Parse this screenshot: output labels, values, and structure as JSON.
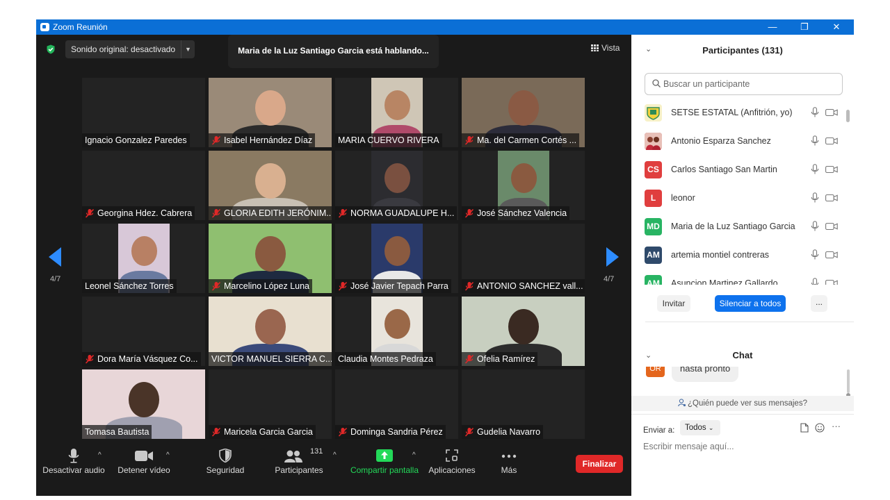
{
  "window": {
    "title": "Zoom Reunión",
    "minimize": "—",
    "restore": "❐",
    "close": "✕"
  },
  "meeting": {
    "original_sound": "Sonido original: desactivado",
    "speaking_banner": "Maria de la Luz Santiago Garcia está hablando...",
    "view_label": "Vista",
    "page_left": "4/7",
    "page_right": "4/7",
    "accent": "#2d8cff",
    "tiles": [
      {
        "name": "Ignacio Gonzalez Paredes",
        "muted": false
      },
      {
        "name": "Isabel Hernández Díaz",
        "muted": true
      },
      {
        "name": "MARIA CUERVO RIVERA",
        "muted": false
      },
      {
        "name": "Ma. del Carmen Cortés ...",
        "muted": true
      },
      {
        "name": "Georgina Hdez. Cabrera",
        "muted": true
      },
      {
        "name": "GLORIA EDITH JERÓNIM...",
        "muted": true
      },
      {
        "name": "NORMA GUADALUPE H...",
        "muted": true
      },
      {
        "name": "José Sánchez Valencia",
        "muted": true
      },
      {
        "name": "Leonel Sánchez Torres",
        "muted": false
      },
      {
        "name": "Marcelino López Luna",
        "muted": true
      },
      {
        "name": "José Javier Tepach Parra",
        "muted": true
      },
      {
        "name": "ANTONIO SANCHEZ vall...",
        "muted": true
      },
      {
        "name": "Dora María Vásquez Co...",
        "muted": true
      },
      {
        "name": "VICTOR MANUEL SIERRA C...",
        "muted": false
      },
      {
        "name": "Claudia Montes Pedraza",
        "muted": false
      },
      {
        "name": "Ofelia Ramírez",
        "muted": true
      },
      {
        "name": "Tomasa Bautista",
        "muted": false
      },
      {
        "name": "Maricela Garcia Garcia",
        "muted": true
      },
      {
        "name": "Dominga Sandria Pérez",
        "muted": true
      },
      {
        "name": "Gudelia Navarro",
        "muted": true
      }
    ]
  },
  "toolbar": {
    "mute": "Desactivar audio",
    "video": "Detener vídeo",
    "security": "Seguridad",
    "participants": "Participantes",
    "participants_count": "131",
    "share": "Compartir pantalla",
    "apps": "Aplicaciones",
    "more": "Más",
    "end": "Finalizar",
    "share_color": "#23d959",
    "end_color": "#e02828"
  },
  "panel": {
    "participants_title": "Participantes (131)",
    "search_placeholder": "Buscar un participante",
    "participants": [
      {
        "initials": "",
        "name": "SETSE ESTATAL (Anfitrión, yo)",
        "color": "#f2d13a"
      },
      {
        "initials": "",
        "name": "Antonio Esparza Sanchez",
        "color": "#c23a3a"
      },
      {
        "initials": "CS",
        "name": "Carlos Santiago San Martin",
        "color": "#e03e3e"
      },
      {
        "initials": "L",
        "name": "leonor",
        "color": "#e03e3e"
      },
      {
        "initials": "MD",
        "name": "Maria de la Luz Santiago Garcia",
        "color": "#28b463"
      },
      {
        "initials": "AM",
        "name": "artemia montiel contreras",
        "color": "#2f4a6b"
      },
      {
        "initials": "AM",
        "name": "Asuncion Martinez Gallardo",
        "color": "#28b463"
      }
    ],
    "invite": "Invitar",
    "mute_all": "Silenciar a todos",
    "more": "...",
    "chat_title": "Chat",
    "chat_avatar": "OR",
    "chat_message": "hasta pronto",
    "who_can_see": "¿Quién puede ver sus mensajes?",
    "send_to_label": "Enviar a:",
    "send_to_value": "Todos",
    "message_placeholder": "Escribir mensaje aquí...",
    "chat_more": "···"
  }
}
